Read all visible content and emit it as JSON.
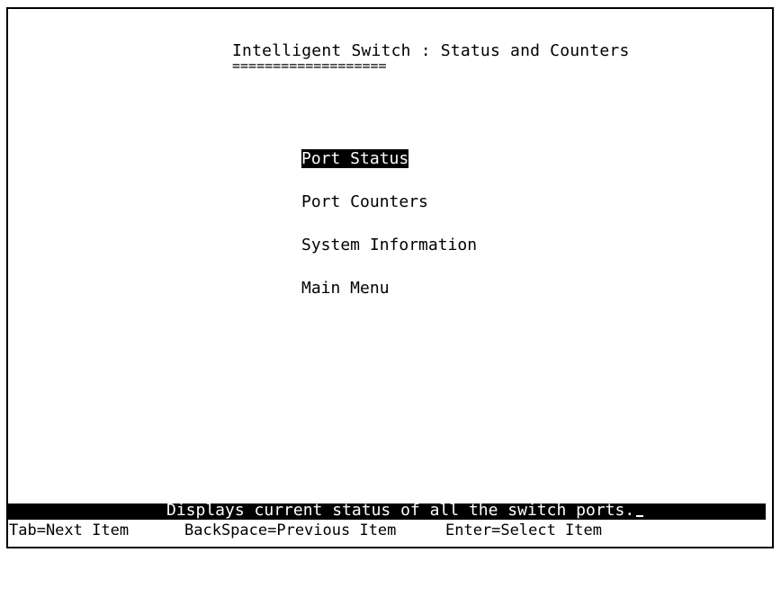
{
  "header": {
    "title": "Intelligent Switch : Status and Counters",
    "underline": "==================="
  },
  "menu": {
    "items": [
      {
        "label": "Port Status",
        "selected": true
      },
      {
        "label": "Port Counters",
        "selected": false
      },
      {
        "label": "System Information",
        "selected": false
      },
      {
        "label": "Main Menu",
        "selected": false
      }
    ]
  },
  "status": {
    "message": "Displays current status of all the switch ports."
  },
  "help": {
    "tab": "Tab=Next Item",
    "backspace": "BackSpace=Previous Item",
    "enter": "Enter=Select Item"
  },
  "colors": {
    "background": "#ffffff",
    "foreground": "#000000",
    "highlight_bg": "#000000",
    "highlight_fg": "#ffffff"
  }
}
